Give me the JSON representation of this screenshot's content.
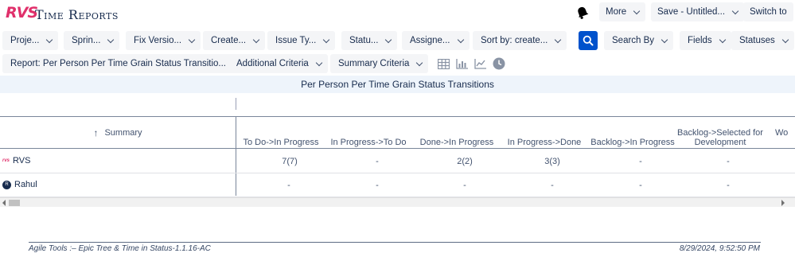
{
  "header": {
    "logo_text": "RVS",
    "app_title": "Time Reports",
    "more_label": "More",
    "save_label": "Save - Untitled...",
    "switch_label": "Switch to"
  },
  "filters": {
    "project": "Proje...",
    "sprint": "Sprin...",
    "fix_version": "Fix Versio...",
    "created": "Create...",
    "issue_type": "Issue Ty...",
    "status": "Statu...",
    "assignee": "Assigne...",
    "sort_by": "Sort by: create...",
    "search_by": "Search By",
    "fields": "Fields",
    "statuses": "Statuses"
  },
  "options": {
    "report": "Report: Per Person Per Time Grain Status Transitio...",
    "additional_criteria": "Additional Criteria",
    "summary_criteria": "Summary Criteria",
    "view_icons": [
      "table-view-icon",
      "bar-chart-icon",
      "line-chart-icon",
      "clock-icon"
    ]
  },
  "report": {
    "title": "Per Person Per Time Grain Status Transitions"
  },
  "table": {
    "summary_header": "Summary",
    "sort_arrow": "↑",
    "columns": [
      "To Do->In Progress",
      "In Progress->To Do",
      "Done->In Progress",
      "In Progress->Done",
      "Backlog->In Progress",
      "Backlog->Selected for Development",
      "Wo"
    ],
    "rows": [
      {
        "name": "RVS",
        "avatar": "rvs",
        "cells": [
          "7(7)",
          "-",
          "2(2)",
          "3(3)",
          "-",
          "-",
          ""
        ]
      },
      {
        "name": "Rahul",
        "avatar": "R",
        "cells": [
          "-",
          "-",
          "-",
          "-",
          "-",
          "-",
          ""
        ]
      }
    ]
  },
  "footer": {
    "left": "Agile Tools :– Epic Tree & Time in Status-1.1.16-AC",
    "right": "8/29/2024, 9:52:50 PM"
  },
  "colors": {
    "accent": "#0052cc",
    "brand": "#e0306b",
    "band": "#eef4fb"
  }
}
